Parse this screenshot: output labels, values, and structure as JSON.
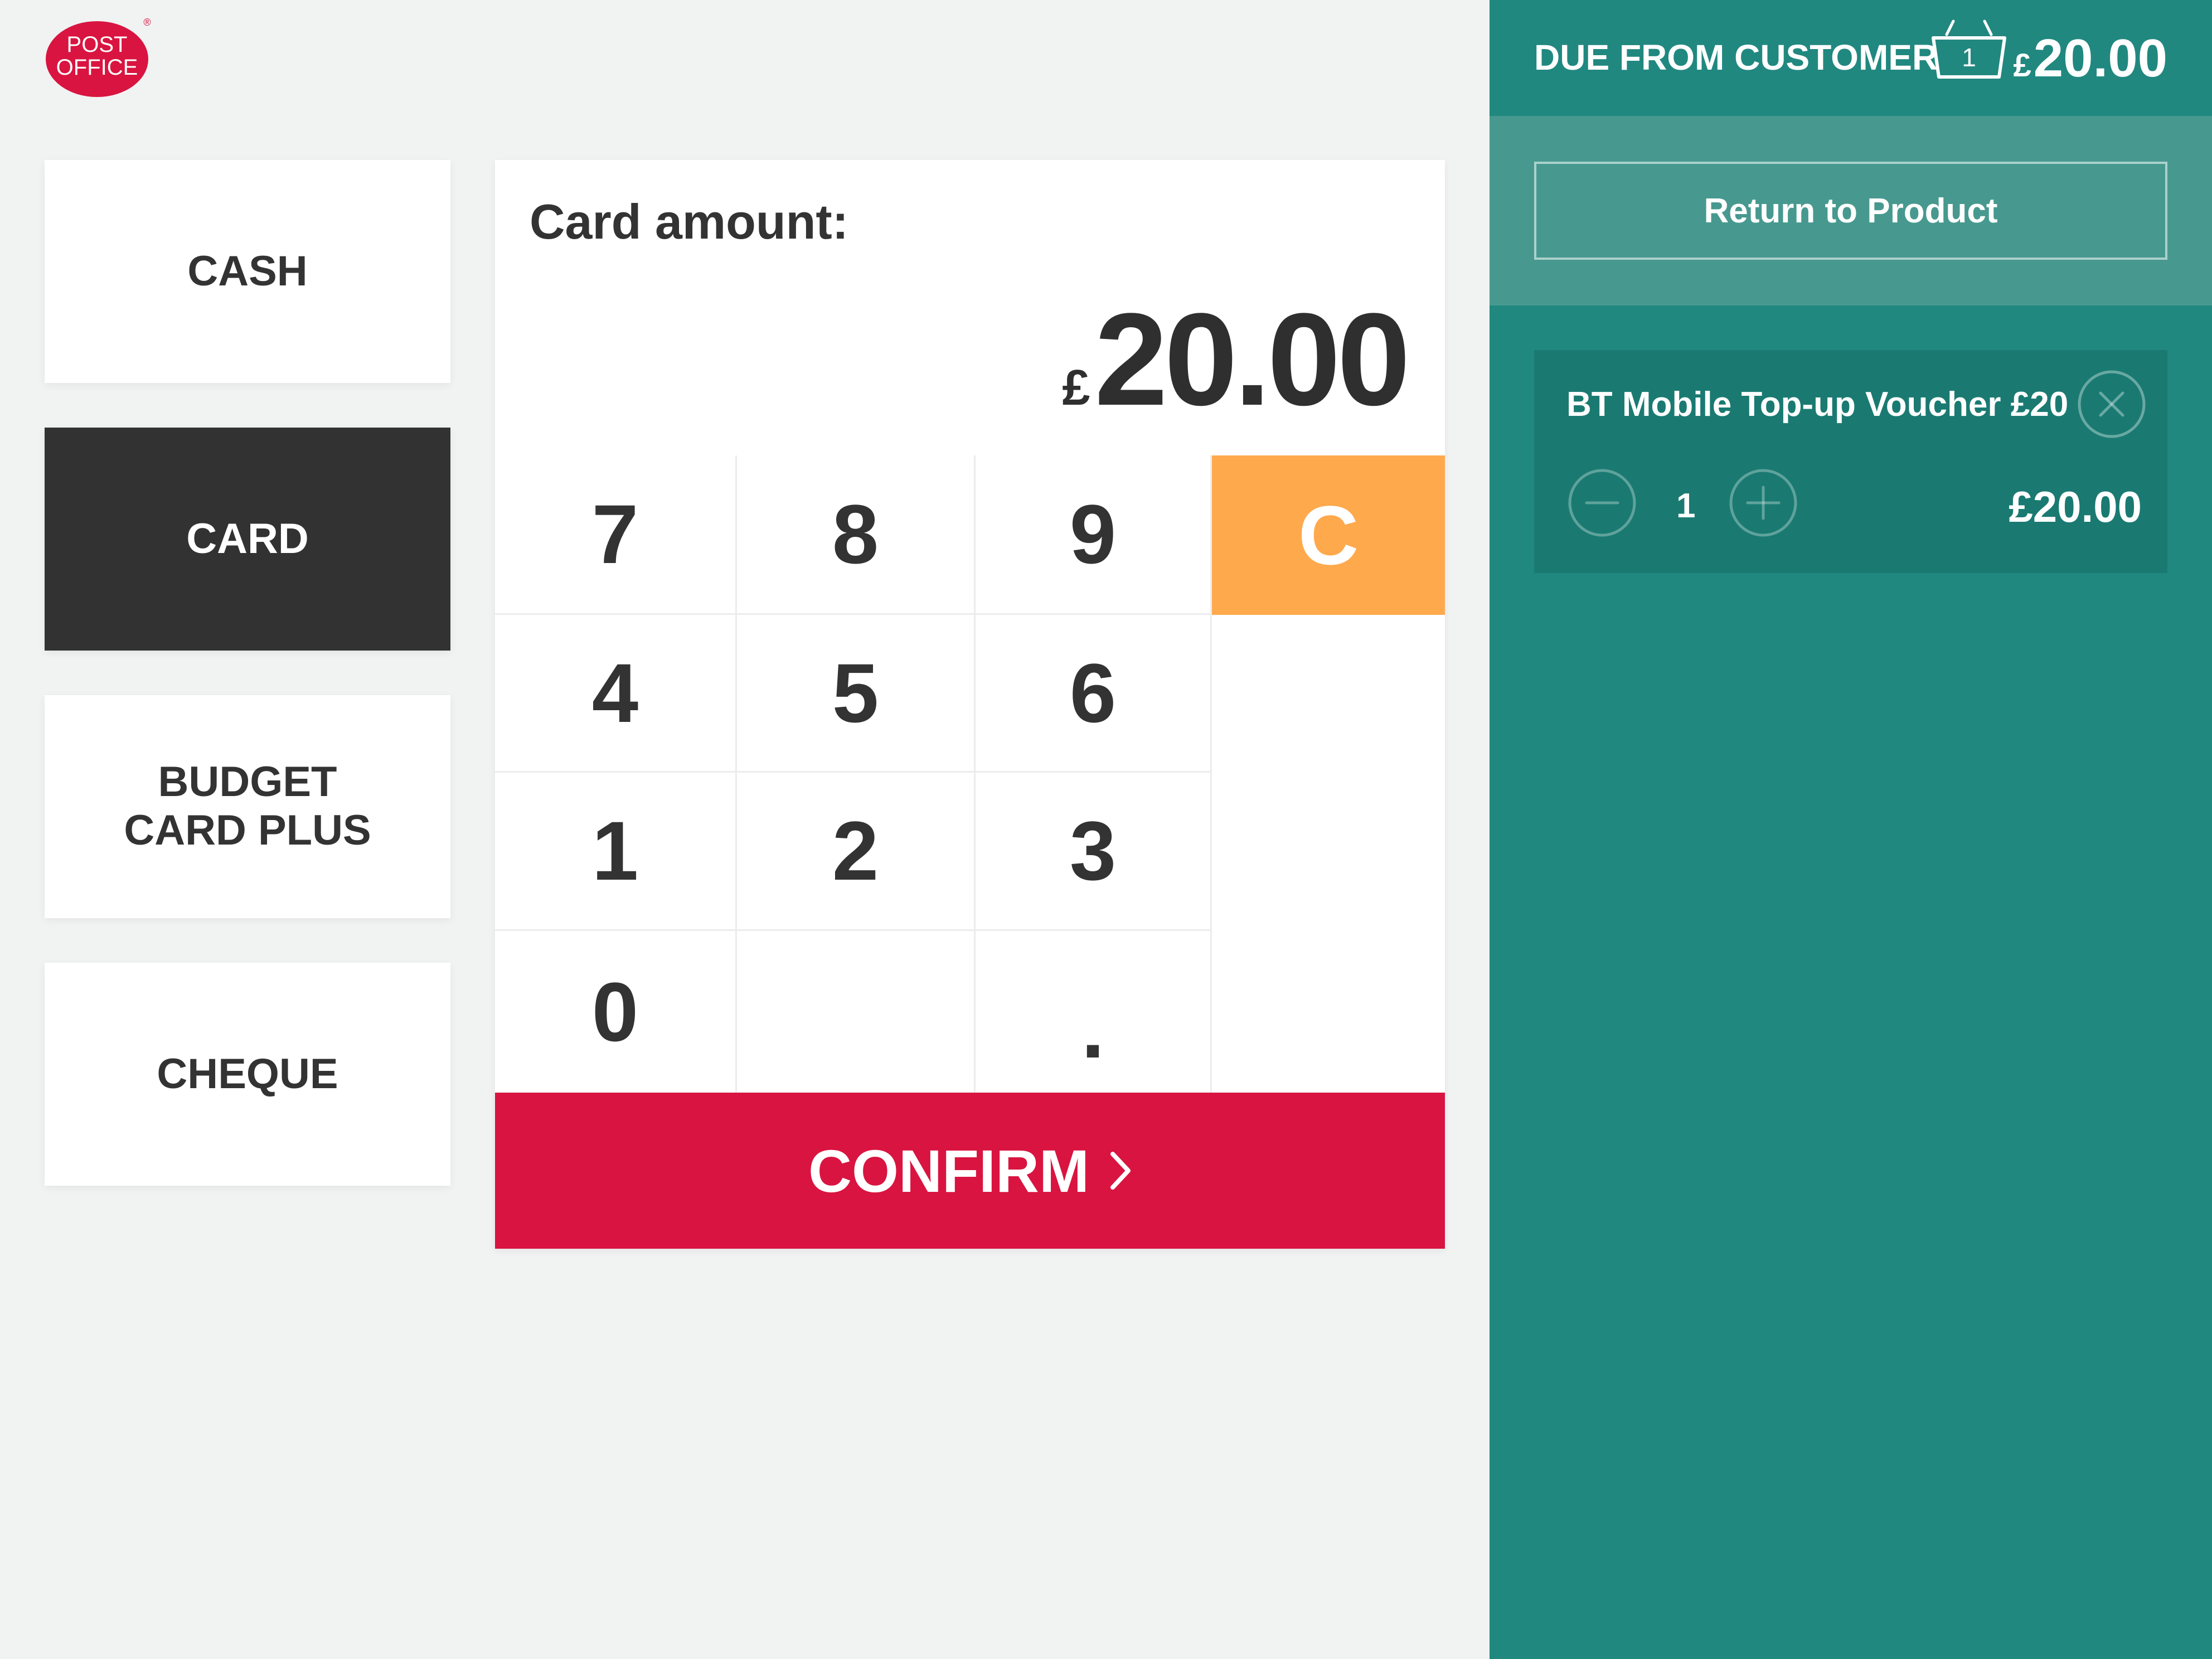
{
  "brand": {
    "logo_line1": "POST",
    "logo_line2": "OFFICE",
    "logo_mark": "®",
    "color": "#d91440"
  },
  "payment_methods": [
    {
      "label": "CASH",
      "active": false
    },
    {
      "label": "CARD",
      "active": true
    },
    {
      "label": "BUDGET\nCARD PLUS",
      "active": false
    },
    {
      "label": "CHEQUE",
      "active": false
    }
  ],
  "amount_panel": {
    "label": "Card amount:",
    "currency_symbol": "£",
    "value": "20.00"
  },
  "keypad": {
    "keys": [
      "7",
      "8",
      "9",
      "C",
      "4",
      "5",
      "6",
      "1",
      "2",
      "3",
      "0",
      "."
    ],
    "clear_color": "#ffa94d"
  },
  "confirm": {
    "label": "CONFIRM",
    "icon": "chevron-right-icon",
    "color": "#d91440"
  },
  "sidebar": {
    "due_label": "DUE FROM CUSTOMER",
    "basket_icon": "basket-icon",
    "basket_count": "1",
    "due_currency": "£",
    "due_amount": "20.00",
    "return_label": "Return to Product",
    "color": "#218880",
    "items": [
      {
        "name": "BT Mobile Top-up Voucher £20",
        "quantity": "1",
        "price": "£20.00"
      }
    ]
  }
}
